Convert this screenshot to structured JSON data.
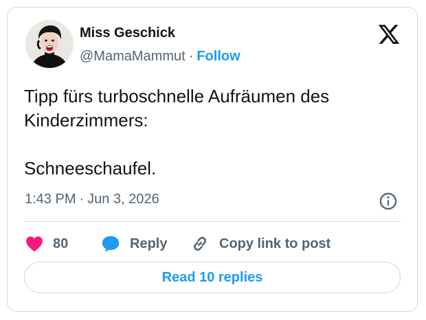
{
  "author": {
    "name": "Miss Geschick",
    "handle": "@MamaMammut",
    "separator": "·",
    "follow_label": "Follow"
  },
  "tweet": {
    "text": "Tipp fürs turboschnelle Aufräumen des\nKinderzimmers:\n\nSchneeschaufel.",
    "time": "1:43 PM",
    "separator": "·",
    "date": "Jun 3, 2026"
  },
  "actions": {
    "like_count": "80",
    "reply_label": "Reply",
    "copy_label": "Copy link to post"
  },
  "read_replies_label": "Read 10 replies",
  "icons": {
    "logo": "x-logo-icon",
    "info": "info-icon",
    "like": "heart-icon",
    "reply": "speech-bubble-icon",
    "copy": "link-icon"
  },
  "colors": {
    "accent": "#1d9bf0",
    "like": "#f91880",
    "text": "#0f1419",
    "muted": "#536471",
    "border": "#cfd9de"
  }
}
